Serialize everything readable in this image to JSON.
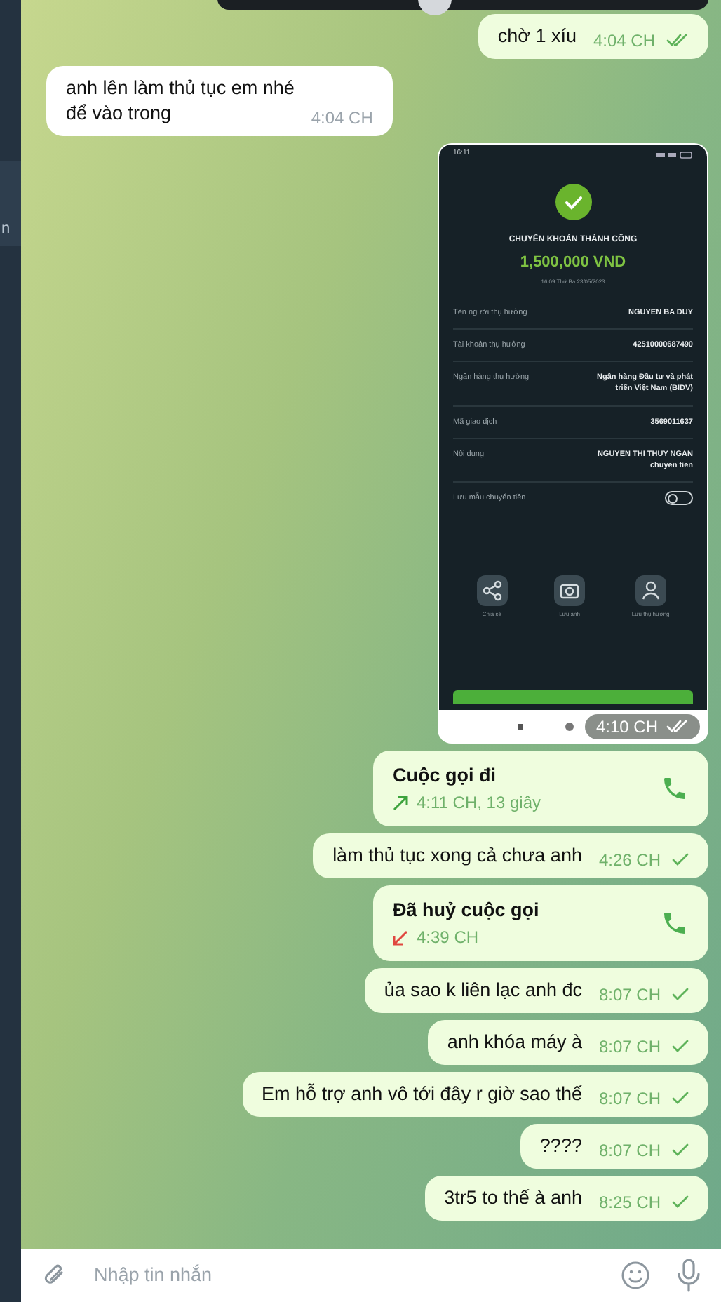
{
  "sidebar": {
    "partial_text": "n"
  },
  "messages": [
    {
      "kind": "text",
      "outgoing": true,
      "text": "chờ 1 xíu",
      "time": "4:04 CH",
      "read": true
    },
    {
      "kind": "text",
      "outgoing": false,
      "lines": [
        "anh lên làm thủ tục em nhé",
        "để vào trong"
      ],
      "time": "4:04 CH"
    },
    {
      "kind": "image",
      "outgoing": true,
      "time": "4:10 CH",
      "read": true,
      "screenshot": {
        "status_time": "16:11",
        "title": "CHUYỂN KHOẢN THÀNH CÔNG",
        "amount": "1,500,000 VND",
        "datetime": "16:09 Thứ Ba 23/05/2023",
        "rows": [
          {
            "label": "Tên người thụ hưởng",
            "value": "NGUYEN BA DUY"
          },
          {
            "label": "Tài khoản thụ hưởng",
            "value": "42510000687490"
          },
          {
            "label": "Ngân hàng thụ hưởng",
            "value": "Ngân hàng Đầu tư và phát triển Việt Nam (BIDV)"
          },
          {
            "label": "Mã giao dịch",
            "value": "3569011637"
          },
          {
            "label": "Nội dung",
            "value": "NGUYEN THI THUY NGAN chuyen tien"
          }
        ],
        "toggle": {
          "label": "Lưu mẫu chuyển tiền",
          "on": false
        },
        "actions": [
          {
            "label": "Chia sẻ",
            "kind": "share"
          },
          {
            "label": "Lưu ảnh",
            "kind": "camera"
          },
          {
            "label": "Lưu thụ hưởng",
            "kind": "person"
          }
        ]
      }
    },
    {
      "kind": "call",
      "outgoing": true,
      "title": "Cuộc gọi đi",
      "detail": "4:11 CH, 13 giây",
      "cancelled": false
    },
    {
      "kind": "text",
      "outgoing": true,
      "text": "làm thủ tục xong cả chưa anh",
      "time": "4:26 CH",
      "read": false
    },
    {
      "kind": "call",
      "outgoing": true,
      "title": "Đã huỷ cuộc gọi",
      "detail": "4:39 CH",
      "cancelled": true
    },
    {
      "kind": "text",
      "outgoing": true,
      "text": "ủa sao k liên lạc anh đc",
      "time": "8:07 CH",
      "read": false
    },
    {
      "kind": "text",
      "outgoing": true,
      "text": "anh khóa máy à",
      "time": "8:07 CH",
      "read": false
    },
    {
      "kind": "text",
      "outgoing": true,
      "text": "Em hỗ trợ anh vô tới đây r giờ sao thế",
      "time": "8:07 CH",
      "read": false
    },
    {
      "kind": "text",
      "outgoing": true,
      "text": "????",
      "time": "8:07 CH",
      "read": false
    },
    {
      "kind": "text",
      "outgoing": true,
      "text": "3tr5 to thế à anh",
      "time": "8:25 CH",
      "read": false
    }
  ],
  "composer": {
    "placeholder": "Nhập tin nhắn"
  }
}
